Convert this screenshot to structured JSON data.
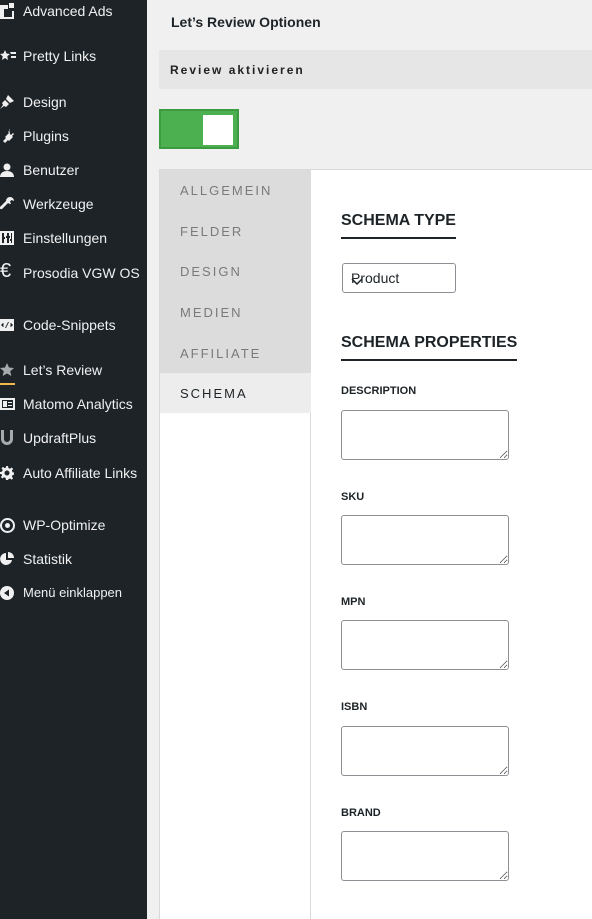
{
  "sidebar": {
    "items": [
      {
        "label": "Advanced Ads",
        "icon": "advanced-ads-icon"
      },
      {
        "label": "Pretty Links",
        "icon": "star-link-icon"
      },
      {
        "label": "Design",
        "icon": "paintbrush-icon"
      },
      {
        "label": "Plugins",
        "icon": "plug-icon"
      },
      {
        "label": "Benutzer",
        "icon": "user-icon"
      },
      {
        "label": "Werkzeuge",
        "icon": "wrench-icon"
      },
      {
        "label": "Einstellungen",
        "icon": "settings-sliders-icon"
      },
      {
        "label": "Prosodia VGW OS",
        "icon": "euro-icon"
      },
      {
        "label": "Code-Snippets",
        "icon": "code-icon"
      },
      {
        "label": "Let’s Review",
        "icon": "star-icon"
      },
      {
        "label": "Matomo Analytics",
        "icon": "analytics-icon"
      },
      {
        "label": "UpdraftPlus",
        "icon": "updraft-icon"
      },
      {
        "label": "Auto Affiliate Links",
        "icon": "gear-icon"
      },
      {
        "label": "WP-Optimize",
        "icon": "optimize-icon"
      },
      {
        "label": "Statistik",
        "icon": "pie-chart-icon"
      },
      {
        "label": "Menü einklappen",
        "icon": "collapse-icon"
      }
    ]
  },
  "main": {
    "title": "Let’s Review Optionen",
    "review_toggle_label": "Review aktivieren",
    "review_enabled": true,
    "tabs": [
      {
        "label": "ALLGEMEIN"
      },
      {
        "label": "FELDER"
      },
      {
        "label": "DESIGN"
      },
      {
        "label": "MEDIEN"
      },
      {
        "label": "AFFILIATE"
      },
      {
        "label": "SCHEMA"
      }
    ],
    "active_tab": "SCHEMA",
    "schema": {
      "type_heading": "SCHEMA TYPE",
      "type_value": "Product",
      "properties_heading": "SCHEMA PROPERTIES",
      "fields": [
        {
          "label": "DESCRIPTION",
          "value": ""
        },
        {
          "label": "SKU",
          "value": ""
        },
        {
          "label": "MPN",
          "value": ""
        },
        {
          "label": "ISBN",
          "value": ""
        },
        {
          "label": "BRAND",
          "value": ""
        }
      ]
    }
  },
  "colors": {
    "sidebar_bg": "#1d2327",
    "toggle_on": "#4caf50",
    "active_accent": "#f0b849"
  }
}
